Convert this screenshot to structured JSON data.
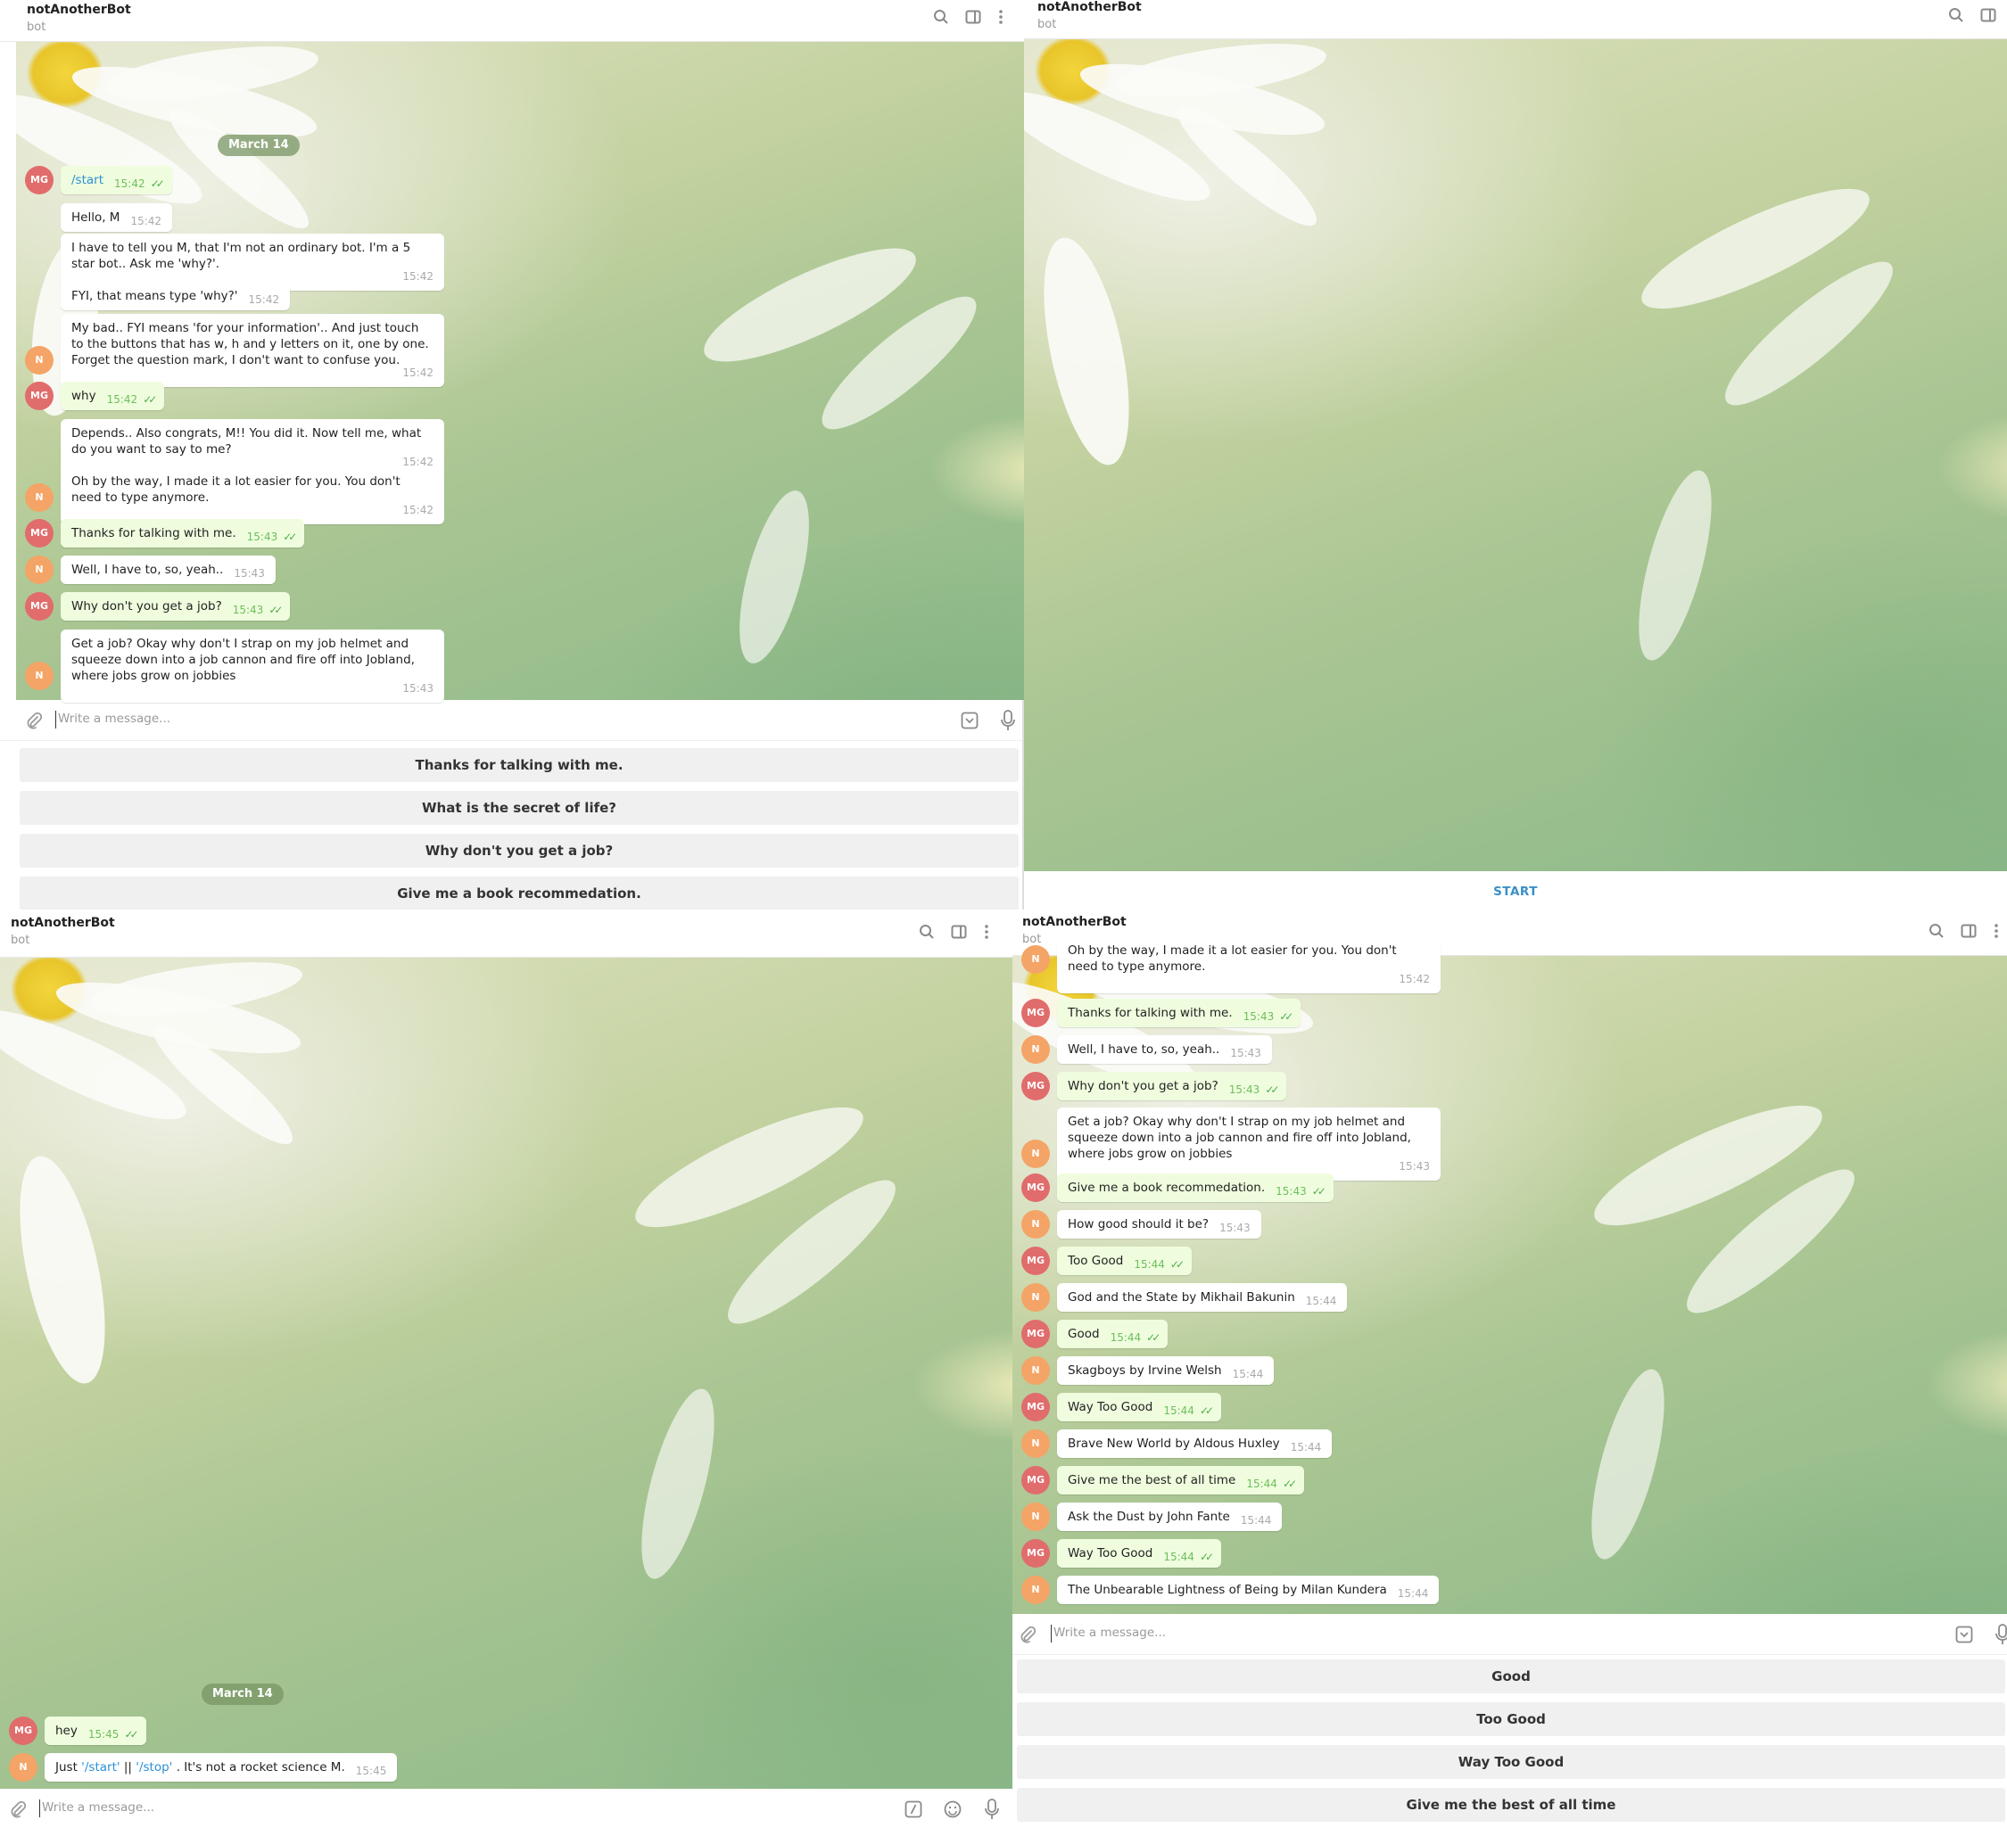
{
  "bot": {
    "name": "notAnotherBot",
    "subtitle": "bot"
  },
  "date_label": "March 14",
  "input_placeholder": "Write a message...",
  "panel1": {
    "messages": [
      {
        "from": "MG",
        "text": "/start",
        "time": "15:42"
      },
      {
        "from": "N",
        "text": "Hello, M",
        "time": "15:42"
      },
      {
        "from": "N",
        "text": "I have to tell you M, that I'm not an ordinary bot. I'm a 5 star bot.. Ask me 'why?'.",
        "time": "15:42"
      },
      {
        "from": "N",
        "text": "FYI, that means type 'why?'",
        "time": "15:42"
      },
      {
        "from": "N",
        "text": "My bad.. FYI means 'for your information'.. And just touch to the buttons that has w, h and y letters on it, one by one. Forget the question mark, I don't want to confuse you.",
        "time": "15:42"
      },
      {
        "from": "MG",
        "text": "why",
        "time": "15:42"
      },
      {
        "from": "N",
        "text": "Depends.. Also congrats, M!! You did it. Now tell me, what do you want to say to me?",
        "time": "15:42"
      },
      {
        "from": "N",
        "text": "Oh by the way, I made it a lot easier for you. You don't need to type anymore.",
        "time": "15:42"
      },
      {
        "from": "MG",
        "text": "Thanks for talking with me.",
        "time": "15:43"
      },
      {
        "from": "N",
        "text": "Well, I have to, so, yeah..",
        "time": "15:43"
      },
      {
        "from": "MG",
        "text": "Why don't you get a job?",
        "time": "15:43"
      },
      {
        "from": "N",
        "text": "Get a job? Okay why don't I strap on my job helmet and squeeze down into a job cannon and fire off into Jobland, where jobs grow on jobbies",
        "time": "15:43"
      }
    ],
    "keyboard": [
      "Thanks for talking with me.",
      "What is the secret of life?",
      "Why don't you get a job?",
      "Give me a book recommedation."
    ]
  },
  "panel2": {
    "start_label": "START"
  },
  "panel3": {
    "messages": [
      {
        "from": "MG",
        "text": "hey",
        "time": "15:45"
      },
      {
        "from": "N",
        "text_parts": [
          "Just ",
          "'/start'",
          " || ",
          "'/stop'",
          " . It's not a rocket science M."
        ],
        "time": "15:45"
      }
    ]
  },
  "panel4": {
    "messages": [
      {
        "from": "N",
        "text": "Oh by the way, I made it a lot easier for you. You don't need to type anymore.",
        "time": "15:42"
      },
      {
        "from": "MG",
        "text": "Thanks for talking with me.",
        "time": "15:43"
      },
      {
        "from": "N",
        "text": "Well, I have to, so, yeah..",
        "time": "15:43"
      },
      {
        "from": "MG",
        "text": "Why don't you get a job?",
        "time": "15:43"
      },
      {
        "from": "N",
        "text": "Get a job? Okay why don't I strap on my job helmet and squeeze down into a job cannon and fire off into Jobland, where jobs grow on jobbies",
        "time": "15:43"
      },
      {
        "from": "MG",
        "text": "Give me a book recommedation.",
        "time": "15:43"
      },
      {
        "from": "N",
        "text": "How good should it be?",
        "time": "15:43"
      },
      {
        "from": "MG",
        "text": "Too Good",
        "time": "15:44"
      },
      {
        "from": "N",
        "text": "God and the State by Mikhail Bakunin",
        "time": "15:44"
      },
      {
        "from": "MG",
        "text": "Good",
        "time": "15:44"
      },
      {
        "from": "N",
        "text": "Skagboys by Irvine Welsh",
        "time": "15:44"
      },
      {
        "from": "MG",
        "text": "Way Too Good",
        "time": "15:44"
      },
      {
        "from": "N",
        "text": "Brave New World by Aldous Huxley",
        "time": "15:44"
      },
      {
        "from": "MG",
        "text": "Give me the best of all time",
        "time": "15:44"
      },
      {
        "from": "N",
        "text": "Ask the Dust by John Fante",
        "time": "15:44"
      },
      {
        "from": "MG",
        "text": "Way Too Good",
        "time": "15:44"
      },
      {
        "from": "N",
        "text": "The Unbearable Lightness of Being by Milan Kundera",
        "time": "15:44"
      }
    ],
    "keyboard": [
      "Good",
      "Too Good",
      "Way Too Good",
      "Give me the best of all time"
    ]
  }
}
